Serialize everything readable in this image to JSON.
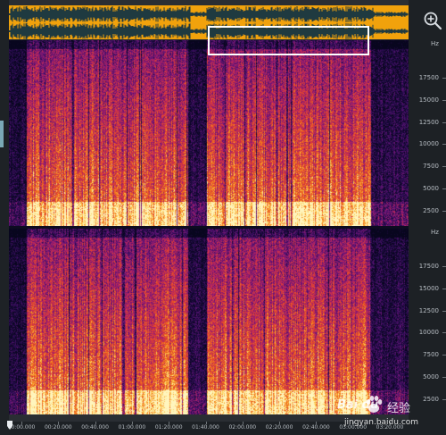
{
  "app": {
    "view": "spectral-frequency-display",
    "accent_color": "#f1a20c"
  },
  "overview": {
    "waveform_color": "#1f3a40",
    "background": "#f1a20c"
  },
  "toolbar": {
    "zoom_icon": "zoom-in-icon"
  },
  "frequency_axis": {
    "unit": "Hz",
    "channel1_ticks": [
      "17500",
      "15000",
      "12500",
      "10000",
      "7500",
      "5000",
      "2500"
    ],
    "channel2_ticks": [
      "17500",
      "15000",
      "12500",
      "10000",
      "7500",
      "5000",
      "2500"
    ]
  },
  "time_axis": {
    "labels": [
      "00:00.000",
      "00:20.000",
      "00:40.000",
      "01:00.000",
      "01:20.000",
      "01:40.000",
      "02:00.000",
      "02:20.000",
      "02:40.000",
      "03:00.000",
      "03:20.000"
    ]
  },
  "watermark": {
    "brand": "Bai du",
    "suffix": "经验",
    "url": "jingyan.baidu.com"
  }
}
